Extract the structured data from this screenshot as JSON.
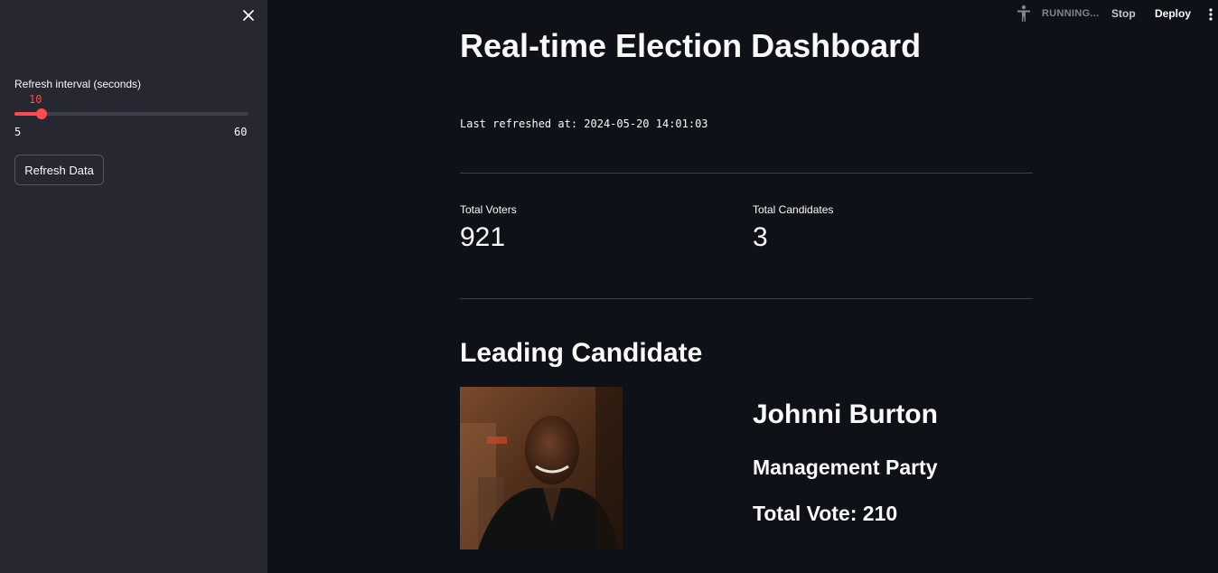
{
  "sidebar": {
    "close_icon": "close-icon",
    "slider": {
      "label": "Refresh interval (seconds)",
      "value": 10,
      "value_text": "10",
      "min": 5,
      "max": 60,
      "min_text": "5",
      "max_text": "60"
    },
    "refresh_button": "Refresh Data"
  },
  "header": {
    "status_icon": "running-person-icon",
    "status": "RUNNING...",
    "stop": "Stop",
    "deploy": "Deploy",
    "menu_icon": "kebab-menu-icon"
  },
  "main": {
    "title": "Real-time Election Dashboard",
    "last_refreshed": "Last refreshed at: 2024-05-20 14:01:03",
    "metrics": [
      {
        "label": "Total Voters",
        "value": "921"
      },
      {
        "label": "Total Candidates",
        "value": "3"
      }
    ],
    "leading_heading": "Leading Candidate",
    "leading": {
      "name": "Johnni Burton",
      "party": "Management Party",
      "votes": "Total Vote: 210"
    }
  },
  "colors": {
    "background": "#0e1117",
    "sidebar": "#262730",
    "accent": "#ff4b4b"
  }
}
